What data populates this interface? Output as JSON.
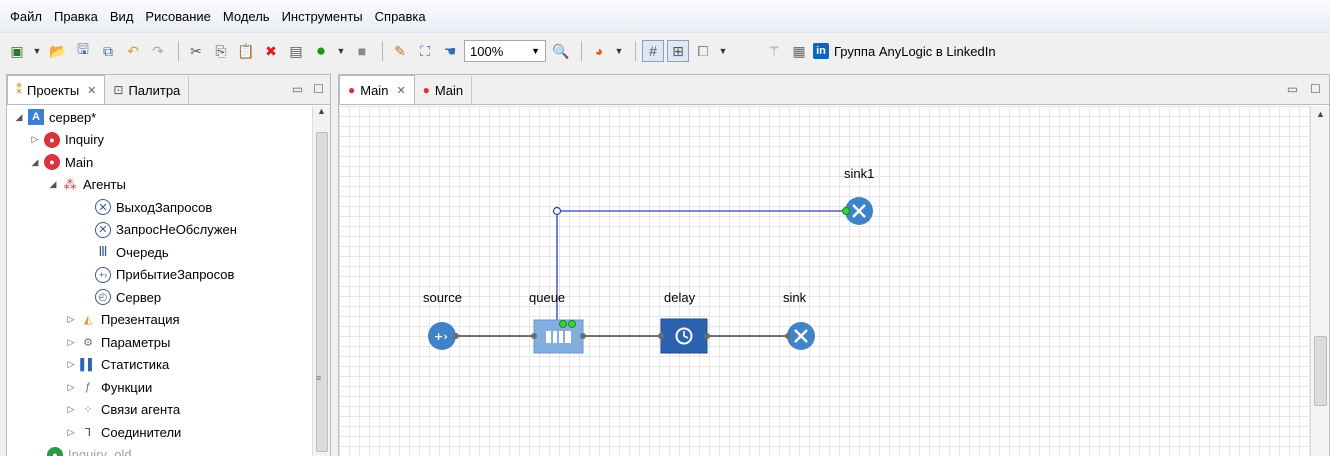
{
  "menu": [
    "Файл",
    "Правка",
    "Вид",
    "Рисование",
    "Модель",
    "Инструменты",
    "Справка"
  ],
  "toolbar": {
    "zoom_value": "100%",
    "linkedin_label": "Группа AnyLogic в LinkedIn",
    "linkedin_badge": "in"
  },
  "left_panel": {
    "tabs": [
      {
        "label": "Проекты",
        "active": true
      },
      {
        "label": "Палитра",
        "active": false
      }
    ],
    "tree": [
      {
        "label": "сервер*",
        "depth": 0,
        "expanded": true,
        "icon": "project-icon"
      },
      {
        "label": "Inquiry",
        "depth": 1,
        "expanded": false,
        "icon": "agent-type-icon"
      },
      {
        "label": "Main",
        "depth": 1,
        "expanded": true,
        "icon": "agent-type-icon"
      },
      {
        "label": "Агенты",
        "depth": 2,
        "expanded": true,
        "icon": "agents-folder-icon"
      },
      {
        "label": "ВыходЗапросов",
        "depth": 3,
        "icon": "sink-icon"
      },
      {
        "label": "ЗапросНеОбслужен",
        "depth": 3,
        "icon": "sink-icon"
      },
      {
        "label": "Очередь",
        "depth": 3,
        "icon": "queue-icon"
      },
      {
        "label": "ПрибытиеЗапросов",
        "depth": 3,
        "icon": "source-icon"
      },
      {
        "label": "Сервер",
        "depth": 3,
        "icon": "delay-icon"
      },
      {
        "label": "Презентация",
        "depth": 2,
        "expanded": false,
        "icon": "presentation-icon"
      },
      {
        "label": "Параметры",
        "depth": 2,
        "expanded": false,
        "icon": "parameters-icon"
      },
      {
        "label": "Статистика",
        "depth": 2,
        "expanded": false,
        "icon": "statistics-icon"
      },
      {
        "label": "Функции",
        "depth": 2,
        "expanded": false,
        "icon": "functions-icon"
      },
      {
        "label": "Связи агента",
        "depth": 2,
        "expanded": false,
        "icon": "agent-links-icon"
      },
      {
        "label": "Соединители",
        "depth": 2,
        "expanded": false,
        "icon": "connectors-icon"
      },
      {
        "label": "Inquiry_old",
        "depth": 1,
        "expanded": false,
        "icon": "agent-type-icon"
      }
    ]
  },
  "editor": {
    "tabs": [
      {
        "label": "Main",
        "active": true
      },
      {
        "label": "Main",
        "active": false
      }
    ],
    "nodes": [
      {
        "name": "source",
        "label": "source",
        "kind": "source"
      },
      {
        "name": "queue",
        "label": "queue",
        "kind": "queue"
      },
      {
        "name": "delay",
        "label": "delay",
        "kind": "delay"
      },
      {
        "name": "sink",
        "label": "sink",
        "kind": "sink"
      },
      {
        "name": "sink1",
        "label": "sink1",
        "kind": "sink"
      }
    ]
  },
  "colors": {
    "block_blue": "#3f84c8",
    "queue_fill": "#85aee0",
    "delay_fill": "#2c62b0",
    "connector_blue": "#3140b8",
    "port_green": "#3ad23a"
  }
}
